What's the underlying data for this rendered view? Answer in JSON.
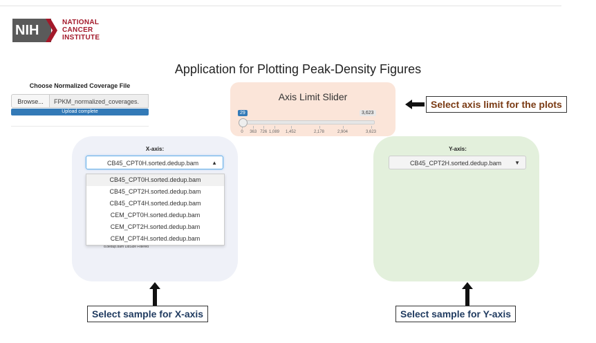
{
  "logo": {
    "nih": "NIH",
    "line1": "NATIONAL",
    "line2": "CANCER",
    "line3": "INSTITUTE"
  },
  "app_title": "Application for Plotting Peak-Density Figures",
  "file_input": {
    "label": "Choose Normalized Coverage File",
    "browse_label": "Browse...",
    "filename": "FPKM_normalized_coverages.",
    "progress_text": "Upload complete",
    "progress": 1.0
  },
  "slider": {
    "title": "Axis Limit Slider",
    "min_badge": "29",
    "max_badge": "3,623",
    "ticks": [
      "0",
      "363",
      "726",
      "1,089",
      "1,452",
      "2,178",
      "2,904",
      "3,623"
    ]
  },
  "callouts": {
    "axis_limit": "Select axis limit for the plots",
    "x_axis": "Select sample for X-axis",
    "y_axis": "Select sample for Y-axis"
  },
  "x_axis": {
    "label": "X-axis:",
    "selected": "CB45_CPT0H.sorted.dedup.bam",
    "options": [
      "CB45_CPT0H.sorted.dedup.bam",
      "CB45_CPT2H.sorted.dedup.bam",
      "CB45_CPT4H.sorted.dedup.bam",
      "CEM_CPT0H.sorted.dedup.bam",
      "CEM_CPT2H.sorted.dedup.bam",
      "CEM_CPT4H.sorted.dedup.bam"
    ],
    "hidden_caption": "d.dedup.bam LibSize Filtered"
  },
  "y_axis": {
    "label": "Y-axis:",
    "selected": "CB45_CPT2H.sorted.dedup.bam"
  },
  "colors": {
    "nci_red": "#a3192a",
    "slider_panel": "#fbe5d9",
    "x_panel": "#eff1f8",
    "y_panel": "#e3f0dc",
    "callout_brown": "#7a3b14",
    "callout_navy": "#1f3a5f",
    "progress_blue": "#337ab7"
  }
}
